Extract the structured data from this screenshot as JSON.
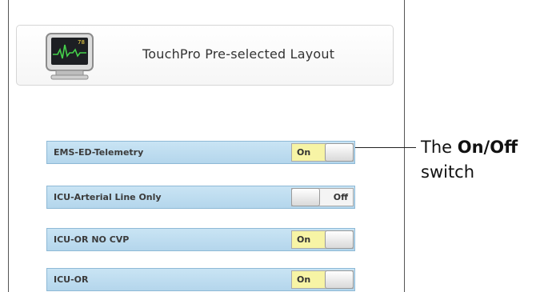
{
  "header": {
    "title": "TouchPro Pre-selected Layout",
    "icon": "patient-monitor-icon",
    "monitor_value": "78"
  },
  "layouts": [
    {
      "label": "EMS-ED-Telemetry",
      "state": "On"
    },
    {
      "label": "ICU-Arterial Line Only",
      "state": "Off"
    },
    {
      "label": "ICU-OR NO CVP",
      "state": "On"
    },
    {
      "label": "ICU-OR",
      "state": "On"
    }
  ],
  "callout": {
    "prefix": "The",
    "bold": "On/Off",
    "suffix": "switch"
  },
  "colors": {
    "row_fill": "#c9e4f4",
    "switch_on": "#f7f4a5",
    "switch_off": "#f4f4f4"
  }
}
